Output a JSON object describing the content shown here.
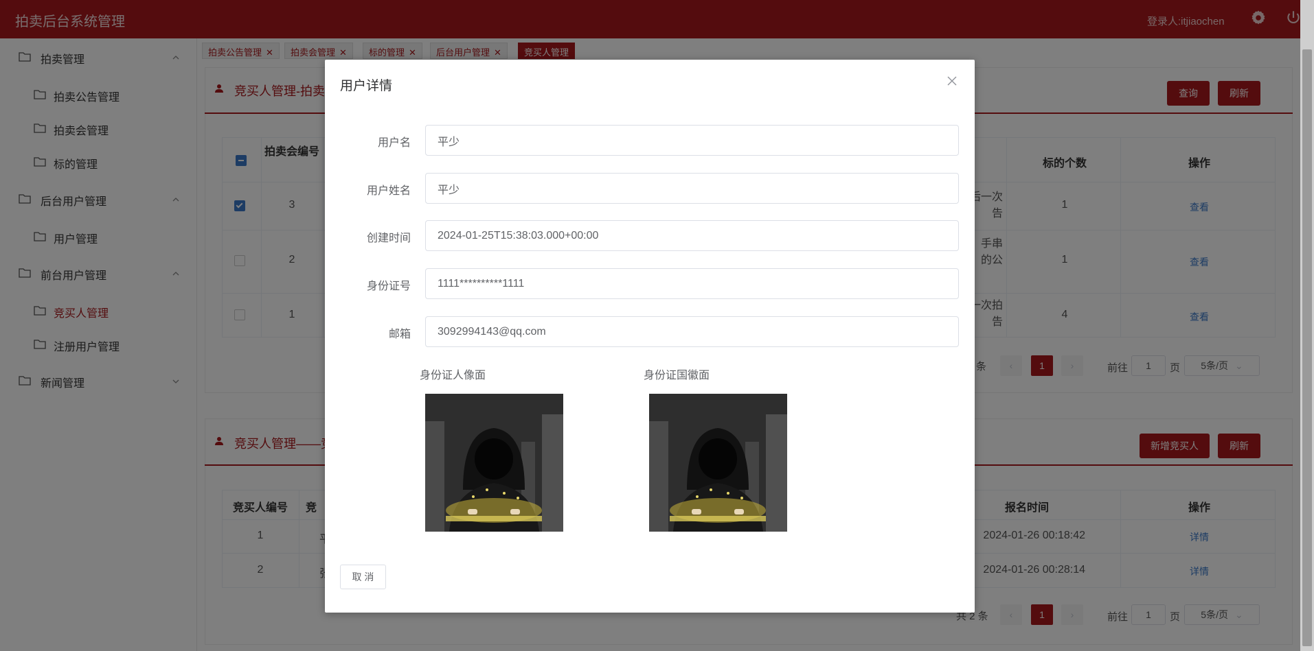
{
  "header": {
    "app_title": "拍卖后台系统管理",
    "login_user": "登录人:itjiaochen"
  },
  "sidebar": {
    "groups": [
      {
        "label": "拍卖管理",
        "items": [
          "拍卖公告管理",
          "拍卖会管理",
          "标的管理"
        ]
      },
      {
        "label": "后台用户管理",
        "items": [
          "用户管理"
        ]
      },
      {
        "label": "前台用户管理",
        "items": [
          "竞买人管理",
          "注册用户管理"
        ]
      },
      {
        "label": "新闻管理",
        "items": []
      }
    ],
    "active_item": "竞买人管理"
  },
  "tabs": [
    {
      "label": "拍卖公告管理",
      "closable": true
    },
    {
      "label": "拍卖会管理",
      "closable": true
    },
    {
      "label": "标的管理",
      "closable": true
    },
    {
      "label": "后台用户管理",
      "closable": true
    },
    {
      "label": "竞买人管理",
      "closable": false,
      "active": true
    }
  ],
  "section1": {
    "title": "竞买人管理-拍卖",
    "query_button": "查询",
    "refresh_button": "刷新",
    "columns": [
      "拍卖会编号",
      "标的个数",
      "操作"
    ],
    "rows": [
      {
        "id": "3",
        "desc": "后一次\n告",
        "count": "1",
        "action": "查看",
        "checked": true
      },
      {
        "id": "2",
        "desc": "手串\n的公",
        "count": "1",
        "action": "查看",
        "checked": false
      },
      {
        "id": "1",
        "desc": "一次拍\n告",
        "count": "4",
        "action": "查看",
        "checked": false
      }
    ],
    "pager": {
      "total_suffix": "条",
      "current": "1",
      "goto": "前往",
      "goto_value": "1",
      "page_unit": "页",
      "page_size": "5条/页"
    }
  },
  "section2": {
    "title": "竞买人管理——竞",
    "add_button": "新增竞买人",
    "refresh_button": "刷新",
    "columns": [
      "竞买人编号",
      "竞",
      "报名时间",
      "操作"
    ],
    "rows": [
      {
        "id": "1",
        "name": "平",
        "time": "2024-01-26 00:18:42",
        "action": "详情"
      },
      {
        "id": "2",
        "name": "张",
        "time": "2024-01-26 00:28:14",
        "action": "详情"
      }
    ],
    "pager": {
      "total": "共 2 条",
      "current": "1",
      "goto": "前往",
      "goto_value": "1",
      "page_unit": "页",
      "page_size": "5条/页"
    }
  },
  "modal": {
    "title": "用户详情",
    "fields": [
      {
        "label": "用户名",
        "value": "平少"
      },
      {
        "label": "用户姓名",
        "value": "平少"
      },
      {
        "label": "创建时间",
        "value": "2024-01-25T15:38:03.000+00:00"
      },
      {
        "label": "身份证号",
        "value": "1111**********1111"
      },
      {
        "label": "邮箱",
        "value": "3092994143@qq.com"
      }
    ],
    "id_front_label": "身份证人像面",
    "id_back_label": "身份证国徽面",
    "cancel_button": "取 消"
  },
  "colors": {
    "brand": "#a8191d",
    "link": "#3a78c8"
  }
}
